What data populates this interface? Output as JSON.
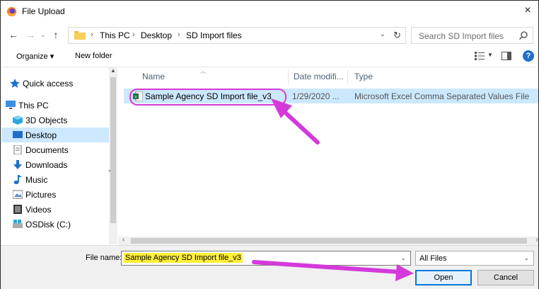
{
  "window": {
    "title": "File Upload",
    "close_glyph": "×"
  },
  "address": {
    "crumbs": [
      "This PC",
      "Desktop",
      "SD Import files"
    ],
    "separator": "›"
  },
  "search": {
    "placeholder": "Search SD Import files"
  },
  "toolbar": {
    "organize_label": "Organize ▾",
    "new_folder_label": "New folder",
    "help_glyph": "?"
  },
  "nav": {
    "items": [
      {
        "label": "Quick access",
        "icon": "star-icon"
      },
      {
        "label": "This PC",
        "icon": "pc-icon"
      },
      {
        "label": "3D Objects",
        "icon": "cube-icon"
      },
      {
        "label": "Desktop",
        "icon": "desktop-icon",
        "selected": true
      },
      {
        "label": "Documents",
        "icon": "document-icon"
      },
      {
        "label": "Downloads",
        "icon": "download-icon"
      },
      {
        "label": "Music",
        "icon": "music-icon"
      },
      {
        "label": "Pictures",
        "icon": "pictures-icon"
      },
      {
        "label": "Videos",
        "icon": "video-icon"
      },
      {
        "label": "OSDisk (C:)",
        "icon": "disk-icon"
      }
    ]
  },
  "filelist": {
    "columns": [
      "Name",
      "Date modifi...",
      "Type"
    ],
    "files": [
      {
        "name": "Sample Agency SD Import file_v3",
        "date": "1/29/2020 ...",
        "type": "Microsoft Excel Comma Separated Values File"
      }
    ]
  },
  "bottom": {
    "file_name_label": "File name:",
    "file_name_value": "Sample Agency SD Import file_v3",
    "file_type_value": "All Files",
    "open_label": "Open",
    "cancel_label": "Cancel"
  },
  "colors": {
    "selection": "#cce8ff",
    "annotation": "#d43ad9",
    "highlight": "#ffef35",
    "accent": "#0078d7"
  }
}
